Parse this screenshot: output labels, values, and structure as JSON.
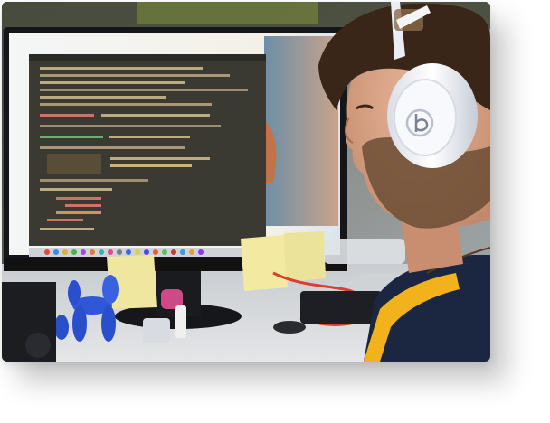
{
  "photo": {
    "subject": "person-wearing-headphones-at-computer",
    "headphone_logo": "b",
    "colors": {
      "screen_code_bg": "#3a3a33",
      "screen_frame": "#e8eef2",
      "headphones": "#e9edf4",
      "shirt_navy": "#1b2740",
      "shirt_yellow": "#f2b21b",
      "sticky_note": "#f2eaa0",
      "cable_red": "#d84030",
      "figure_blue": "#2f57d6"
    }
  }
}
